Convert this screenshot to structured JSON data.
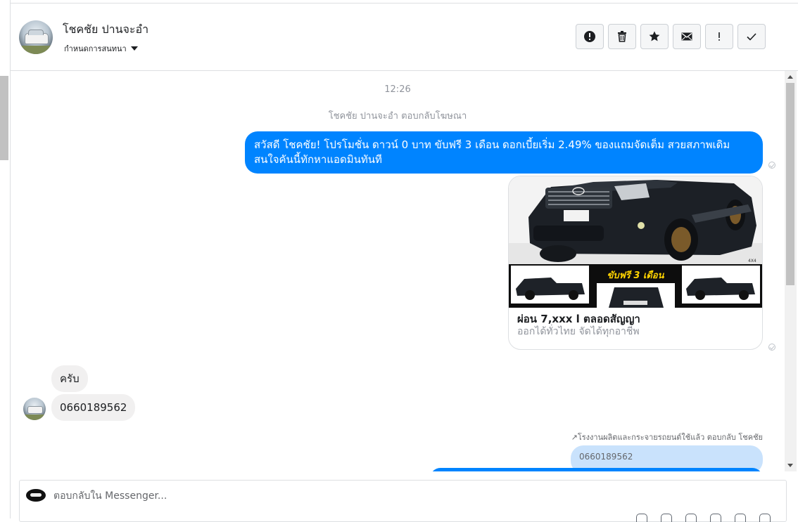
{
  "header": {
    "contact_name": "โชคชัย ปานจะอำ",
    "assign_label": "กำหนดการสนทนา",
    "actions": [
      {
        "name": "report-button",
        "icon": "alert-circle-icon"
      },
      {
        "name": "delete-button",
        "icon": "trash-icon"
      },
      {
        "name": "star-button",
        "icon": "star-icon"
      },
      {
        "name": "mark-unread-button",
        "icon": "envelope-icon"
      },
      {
        "name": "follow-up-button",
        "icon": "exclamation-icon"
      },
      {
        "name": "mark-done-button",
        "icon": "check-icon"
      }
    ]
  },
  "thread": {
    "timestamp": "12:26",
    "ad_reply_note": "โชคชัย ปานจะอำ ตอบกลับโฆษณา",
    "outgoing_message": "สวัสดี โชคชัย! โปรโมชั่น ดาวน์ 0 บาท ขับฟรี 3 เดือน ดอกเบี้ยเริ่ม 2.49% ของแถมจัดเต็ม สวยสภาพเดิม สนใจคันนี้ทักหาแอดมินทันที",
    "ad_card": {
      "banner_text": "ขับฟรี 3 เดือน",
      "badge": "4X4",
      "title": "ผ่อน 7,xxx l ตลอดสัญญา",
      "subtitle": "ออกได้ทั่วไทย จัดได้ทุกอาชีพ"
    },
    "incoming_messages": [
      "ครับ",
      "0660189562"
    ],
    "reply_note": "↗โรงงานผลิตและกระจายรถยนต์ใช้แล้ว ตอบกลับ โชคชัย",
    "quoted_text": "0660189562"
  },
  "composer": {
    "placeholder": "ตอบกลับใน Messenger..."
  },
  "colors": {
    "messenger_blue": "#0084ff",
    "incoming_gray": "#f1f0f0",
    "quoted_blue": "#c9e2fc",
    "banner_yellow": "#ffd400"
  }
}
